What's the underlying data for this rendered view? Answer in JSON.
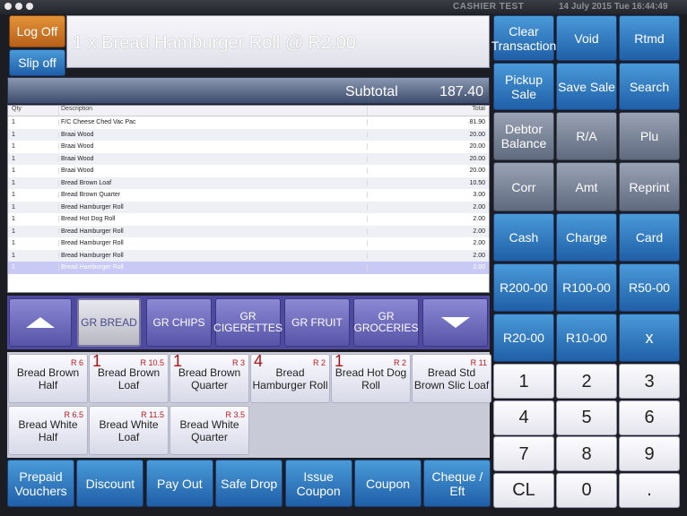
{
  "titlebar": {
    "title": "CASHIER TEST",
    "datetime": "14 July 2015 Tue 16:44:49"
  },
  "left": {
    "log_off": "Log Off",
    "slip_off": "Slip off"
  },
  "display": {
    "text": "1 x Bread Hamburger Roll @ R2.00"
  },
  "subtotal": {
    "label": "Subtotal",
    "value": "187.40"
  },
  "grid": {
    "headers": {
      "qty": "Qty",
      "description": "Description",
      "total": "Total"
    },
    "rows": [
      {
        "qty": "1",
        "desc": "F/C Cheese Ched Vac Pac",
        "total": "81.90"
      },
      {
        "qty": "1",
        "desc": "Braai Wood",
        "total": "20.00"
      },
      {
        "qty": "1",
        "desc": "Braai Wood",
        "total": "20.00"
      },
      {
        "qty": "1",
        "desc": "Braai Wood",
        "total": "20.00"
      },
      {
        "qty": "1",
        "desc": "Braai Wood",
        "total": "20.00"
      },
      {
        "qty": "1",
        "desc": "Bread Brown Loaf",
        "total": "10.50"
      },
      {
        "qty": "1",
        "desc": "Bread Brown Quarter",
        "total": "3.00"
      },
      {
        "qty": "1",
        "desc": "Bread Hamburger Roll",
        "total": "2.00"
      },
      {
        "qty": "1",
        "desc": "Bread Hot Dog Roll",
        "total": "2.00"
      },
      {
        "qty": "1",
        "desc": "Bread Hamburger Roll",
        "total": "2.00"
      },
      {
        "qty": "1",
        "desc": "Bread Hamburger Roll",
        "total": "2.00"
      },
      {
        "qty": "1",
        "desc": "Bread Hamburger Roll",
        "total": "2.00"
      },
      {
        "qty": "1",
        "desc": "Bread Hamburger Roll",
        "total": "2.00"
      }
    ]
  },
  "categories": {
    "items": [
      "GR BREAD",
      "GR CHIPS",
      "GR CIGERETTES",
      "GR FRUIT",
      "GR GROCERIES"
    ],
    "up_icon": "arrow-up-icon",
    "down_icon": "arrow-down-icon"
  },
  "products": [
    {
      "name": "Bread Brown Half",
      "price": "R 6",
      "qty": ""
    },
    {
      "name": "Bread Brown Loaf",
      "price": "R 10.5",
      "qty": "1"
    },
    {
      "name": "Bread Brown Quarter",
      "price": "R 3",
      "qty": "1"
    },
    {
      "name": "Bread Hamburger Roll",
      "price": "R 2",
      "qty": "4"
    },
    {
      "name": "Bread Hot Dog Roll",
      "price": "R 2",
      "qty": "1"
    },
    {
      "name": "Bread Std Brown Slic Loaf",
      "price": "R 11",
      "qty": ""
    },
    {
      "name": "Bread White Half",
      "price": "R 6.5",
      "qty": ""
    },
    {
      "name": "Bread White Loaf",
      "price": "R 11.5",
      "qty": ""
    },
    {
      "name": "Bread White Quarter",
      "price": "R 3.5",
      "qty": ""
    }
  ],
  "functions": [
    "Prepaid Vouchers",
    "Discount",
    "Pay Out",
    "Safe Drop",
    "Issue Coupon",
    "Coupon",
    "Cheque / Eft"
  ],
  "right": {
    "row1": [
      "Clear Transaction",
      "Void",
      "Rtmd"
    ],
    "row2": [
      "Pickup Sale",
      "Save Sale",
      "Search"
    ],
    "row3": [
      "Debtor Balance",
      "R/A",
      "Plu"
    ],
    "row4": [
      "Corr",
      "Amt",
      "Reprint"
    ],
    "row5": [
      "Cash",
      "Charge",
      "Card"
    ],
    "row6": [
      "R200-00",
      "R100-00",
      "R50-00"
    ],
    "row7": [
      "R20-00",
      "R10-00",
      "x"
    ],
    "keypad": [
      "1",
      "2",
      "3",
      "4",
      "5",
      "6",
      "7",
      "8",
      "9",
      "CL",
      "0",
      "."
    ]
  },
  "colors": {
    "accent_blue": "#1f5fa8",
    "orange": "#d07a28",
    "purple": "#5854a8",
    "price_red": "#c01818"
  }
}
